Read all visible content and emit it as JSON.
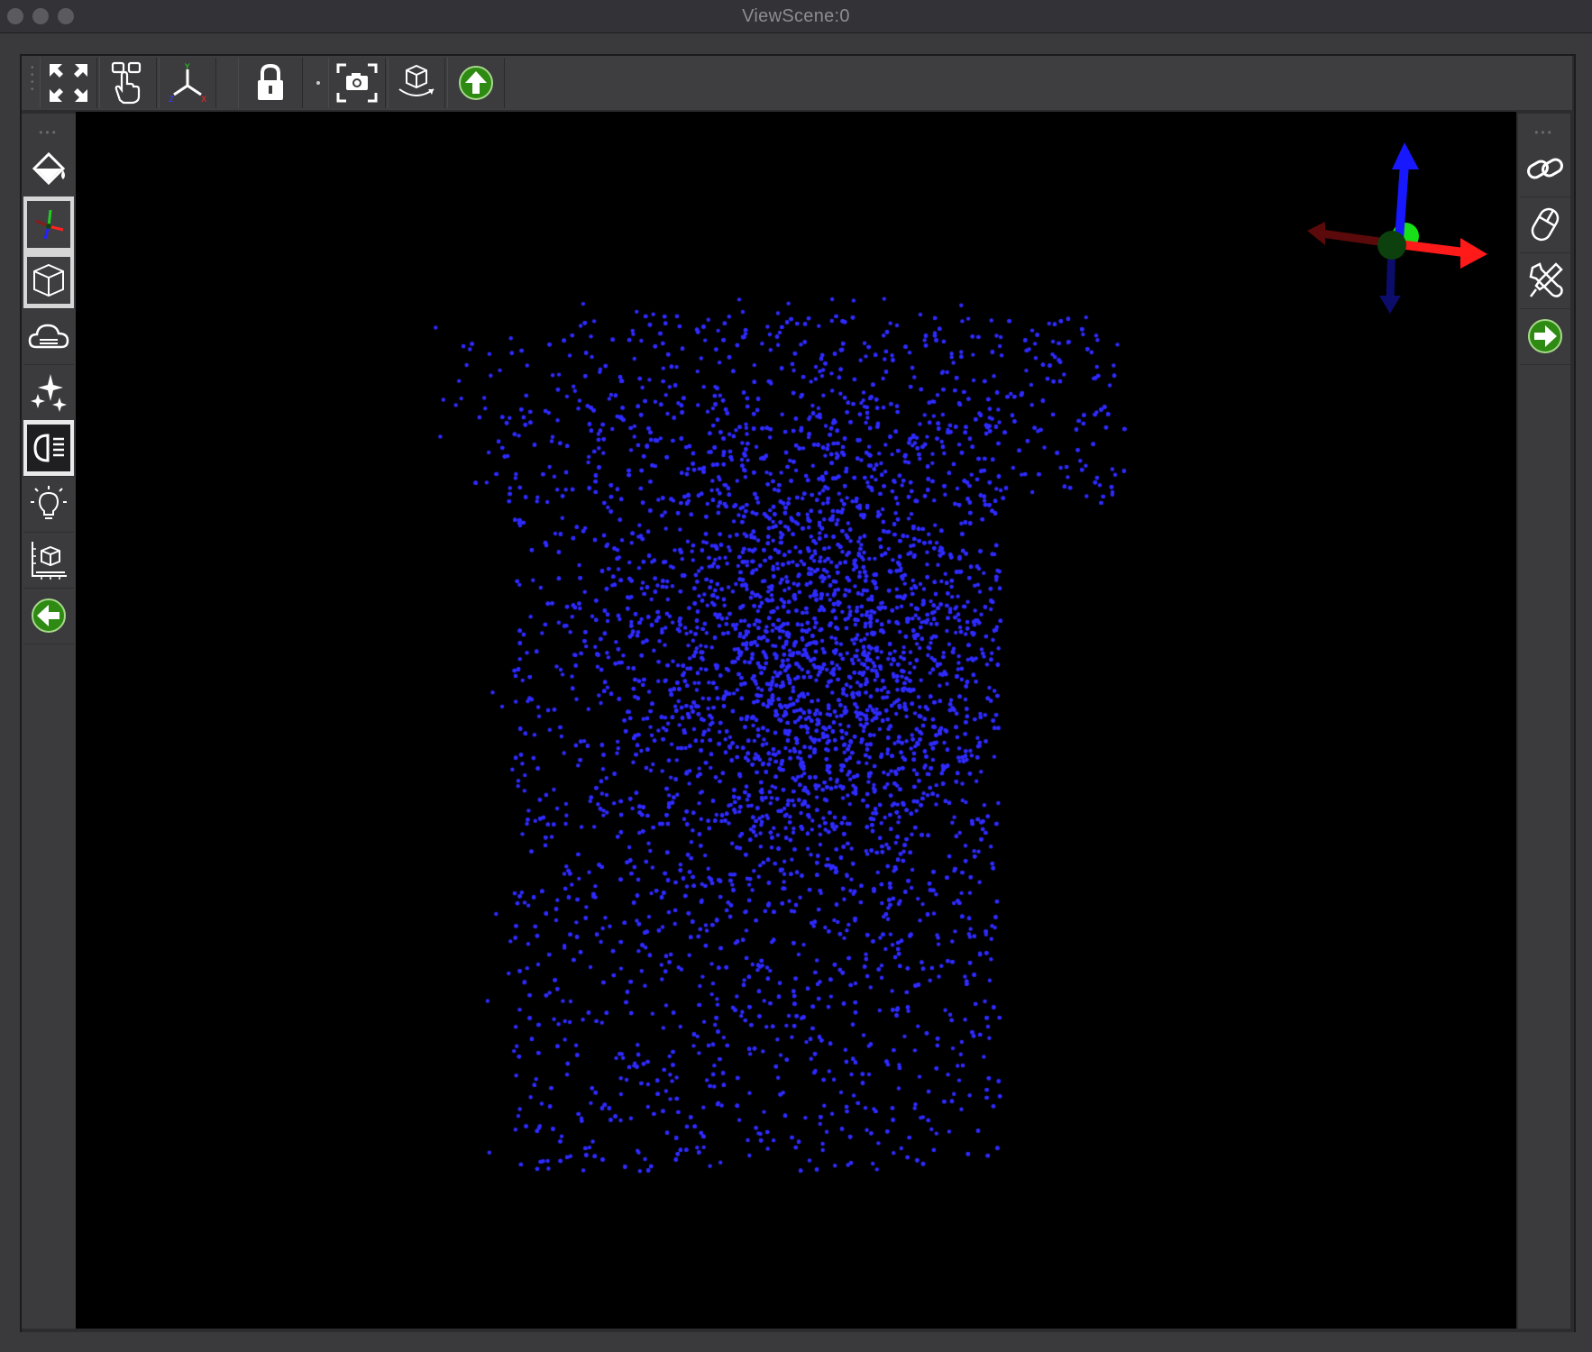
{
  "window": {
    "title": "ViewScene:0"
  },
  "top_toolbar": {
    "buttons": [
      {
        "id": "fit-view",
        "icon": "expand-arrows-icon"
      },
      {
        "id": "interaction-mode",
        "icon": "hand-pointer-icon"
      },
      {
        "id": "axis-view",
        "icon": "xyz-axes-icon"
      },
      {
        "id": "lock-view",
        "icon": "lock-icon"
      },
      {
        "id": "screenshot",
        "icon": "camera-frame-icon"
      },
      {
        "id": "auto-rotate",
        "icon": "rotating-cube-icon"
      },
      {
        "id": "collapse-toolbar",
        "icon": "green-up-arrow-icon"
      }
    ]
  },
  "left_toolbar": {
    "buttons": [
      {
        "id": "background-color",
        "icon": "paint-bucket-icon",
        "active": false
      },
      {
        "id": "orientation-axes",
        "icon": "axes-icon",
        "active": true
      },
      {
        "id": "bounding-box",
        "icon": "wire-cube-icon",
        "active": true
      },
      {
        "id": "fog",
        "icon": "cloud-icon",
        "active": false
      },
      {
        "id": "stars",
        "icon": "sparkle-icon",
        "active": false
      },
      {
        "id": "headlight",
        "icon": "headlight-icon",
        "active": true
      },
      {
        "id": "lighting",
        "icon": "light-bulb-icon",
        "active": false
      },
      {
        "id": "scale-bar",
        "icon": "ruler-cube-icon",
        "active": false
      },
      {
        "id": "collapse-left",
        "icon": "green-left-arrow-icon",
        "active": false
      }
    ]
  },
  "right_toolbar": {
    "buttons": [
      {
        "id": "link-views",
        "icon": "chain-link-icon"
      },
      {
        "id": "mouse-controls",
        "icon": "mouse-icon"
      },
      {
        "id": "tools",
        "icon": "wrench-screwdriver-icon"
      },
      {
        "id": "collapse-right",
        "icon": "green-right-arrow-icon"
      }
    ]
  },
  "viewport": {
    "background": "#000000",
    "point_color": "#2f2bff",
    "axis_colors": {
      "x": "#ff1a1a",
      "y": "#22dd22",
      "z": "#1515ff"
    }
  }
}
